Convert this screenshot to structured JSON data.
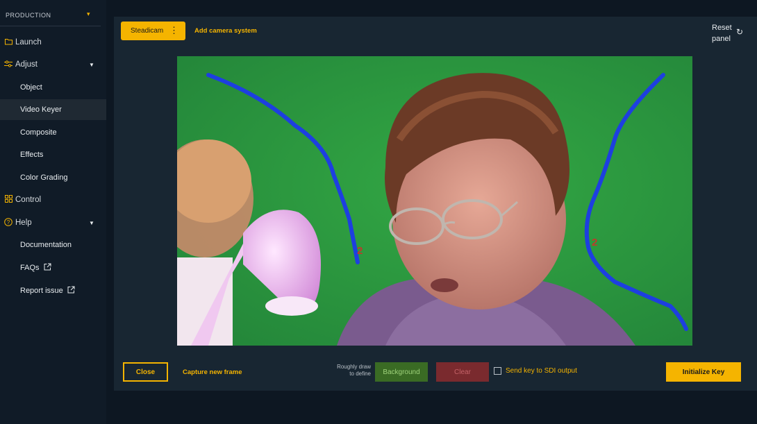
{
  "sidebar": {
    "mode_label": "PRODUCTION",
    "launch": "Launch",
    "adjust": "Adjust",
    "adjust_items": [
      "Object",
      "Video Keyer",
      "Composite",
      "Effects",
      "Color Grading"
    ],
    "control": "Control",
    "help": "Help",
    "help_items": [
      "Documentation",
      "FAQs",
      "Report issue"
    ],
    "active_item": "Video Keyer"
  },
  "toolbar": {
    "camera_label": "Steadicam",
    "add_camera": "Add camera system",
    "reset_line1": "Reset",
    "reset_line2": "panel"
  },
  "frame": {
    "stroke_color": "#1d3fe0",
    "annotation_label_left": "2",
    "annotation_label_right": "2",
    "background_color": "#2e9c3d"
  },
  "footer": {
    "close_label": "Close",
    "capture_label": "Capture new frame",
    "hint_line1": "Roughly draw",
    "hint_line2": "to define",
    "background_label": "Background",
    "clear_label": "Clear",
    "sdi_label": "Send key to SDI output",
    "sdi_checked": false,
    "initialize_label": "Initialize Key"
  },
  "colors": {
    "accent": "#f5b400",
    "background_btn": "#3a6b24",
    "clear_btn": "#7a2a2e"
  }
}
